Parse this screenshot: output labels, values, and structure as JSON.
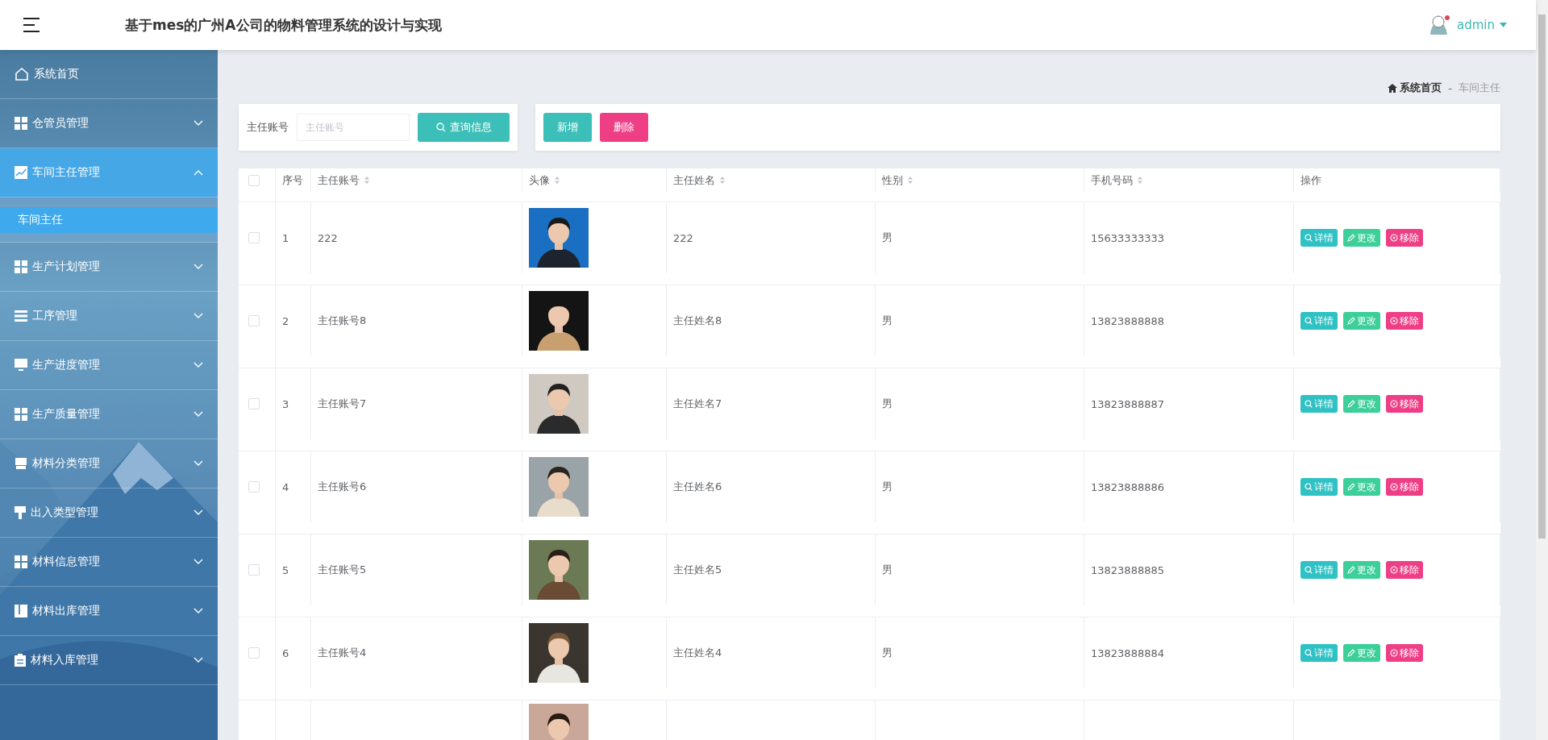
{
  "header": {
    "title": "基于mes的广州A公司的物料管理系统的设计与实现",
    "user": "admin"
  },
  "sidebar": {
    "items": [
      {
        "label": "系统首页",
        "kind": "link",
        "selected": false
      },
      {
        "label": "仓管员管理",
        "kind": "menu",
        "selected": false,
        "expanded": false
      },
      {
        "label": "车间主任管理",
        "kind": "menu",
        "selected": true,
        "expanded": true,
        "children": [
          {
            "label": "车间主任",
            "selected": true
          }
        ]
      },
      {
        "label": "生产计划管理",
        "kind": "menu",
        "selected": false,
        "expanded": false
      },
      {
        "label": "工序管理",
        "kind": "menu",
        "selected": false,
        "expanded": false
      },
      {
        "label": "生产进度管理",
        "kind": "menu",
        "selected": false,
        "expanded": false
      },
      {
        "label": "生产质量管理",
        "kind": "menu",
        "selected": false,
        "expanded": false
      },
      {
        "label": "材料分类管理",
        "kind": "menu",
        "selected": false,
        "expanded": false
      },
      {
        "label": "出入类型管理",
        "kind": "menu",
        "selected": false,
        "expanded": false
      },
      {
        "label": "材料信息管理",
        "kind": "menu",
        "selected": false,
        "expanded": false
      },
      {
        "label": "材料出库管理",
        "kind": "menu",
        "selected": false,
        "expanded": false
      },
      {
        "label": "材料入库管理",
        "kind": "menu",
        "selected": false,
        "expanded": false
      }
    ]
  },
  "breadcrumb": {
    "home": "系统首页",
    "separator": "-",
    "current": "车间主任"
  },
  "search": {
    "label": "主任账号",
    "placeholder": "主任账号",
    "button": "查询信息"
  },
  "toolbar": {
    "add": "新增",
    "delete": "删除"
  },
  "table": {
    "header_checkbox": {
      "checked": false
    },
    "columns": [
      {
        "label": "序号",
        "sortable": false
      },
      {
        "label": "主任账号",
        "sortable": true
      },
      {
        "label": "头像",
        "sortable": true
      },
      {
        "label": "主任姓名",
        "sortable": true
      },
      {
        "label": "性别",
        "sortable": true
      },
      {
        "label": "手机号码",
        "sortable": true
      },
      {
        "label": "操作",
        "sortable": false
      }
    ],
    "rows": [
      {
        "checked": false,
        "index": "1",
        "account": "222",
        "name": "222",
        "gender": "男",
        "phone": "15633333333",
        "actions": [
          {
            "kind": "detail",
            "label": "详情"
          },
          {
            "kind": "edit",
            "label": "更改"
          },
          {
            "kind": "remove",
            "label": "移除"
          }
        ]
      },
      {
        "checked": false,
        "index": "2",
        "account": "主任账号8",
        "name": "主任姓名8",
        "gender": "男",
        "phone": "13823888888",
        "actions": [
          {
            "kind": "detail",
            "label": "详情"
          },
          {
            "kind": "edit",
            "label": "更改"
          },
          {
            "kind": "remove",
            "label": "移除"
          }
        ]
      },
      {
        "checked": false,
        "index": "3",
        "account": "主任账号7",
        "name": "主任姓名7",
        "gender": "男",
        "phone": "13823888887",
        "actions": [
          {
            "kind": "detail",
            "label": "详情"
          },
          {
            "kind": "edit",
            "label": "更改"
          },
          {
            "kind": "remove",
            "label": "移除"
          }
        ]
      },
      {
        "checked": false,
        "index": "4",
        "account": "主任账号6",
        "name": "主任姓名6",
        "gender": "男",
        "phone": "13823888886",
        "actions": [
          {
            "kind": "detail",
            "label": "详情"
          },
          {
            "kind": "edit",
            "label": "更改"
          },
          {
            "kind": "remove",
            "label": "移除"
          }
        ]
      },
      {
        "checked": false,
        "index": "5",
        "account": "主任账号5",
        "name": "主任姓名5",
        "gender": "男",
        "phone": "13823888885",
        "actions": [
          {
            "kind": "detail",
            "label": "详情"
          },
          {
            "kind": "edit",
            "label": "更改"
          },
          {
            "kind": "remove",
            "label": "移除"
          }
        ]
      },
      {
        "checked": false,
        "index": "6",
        "account": "主任账号4",
        "name": "主任姓名4",
        "gender": "男",
        "phone": "13823888884",
        "actions": [
          {
            "kind": "detail",
            "label": "详情"
          },
          {
            "kind": "edit",
            "label": "更改"
          },
          {
            "kind": "remove",
            "label": "移除"
          }
        ]
      }
    ]
  }
}
